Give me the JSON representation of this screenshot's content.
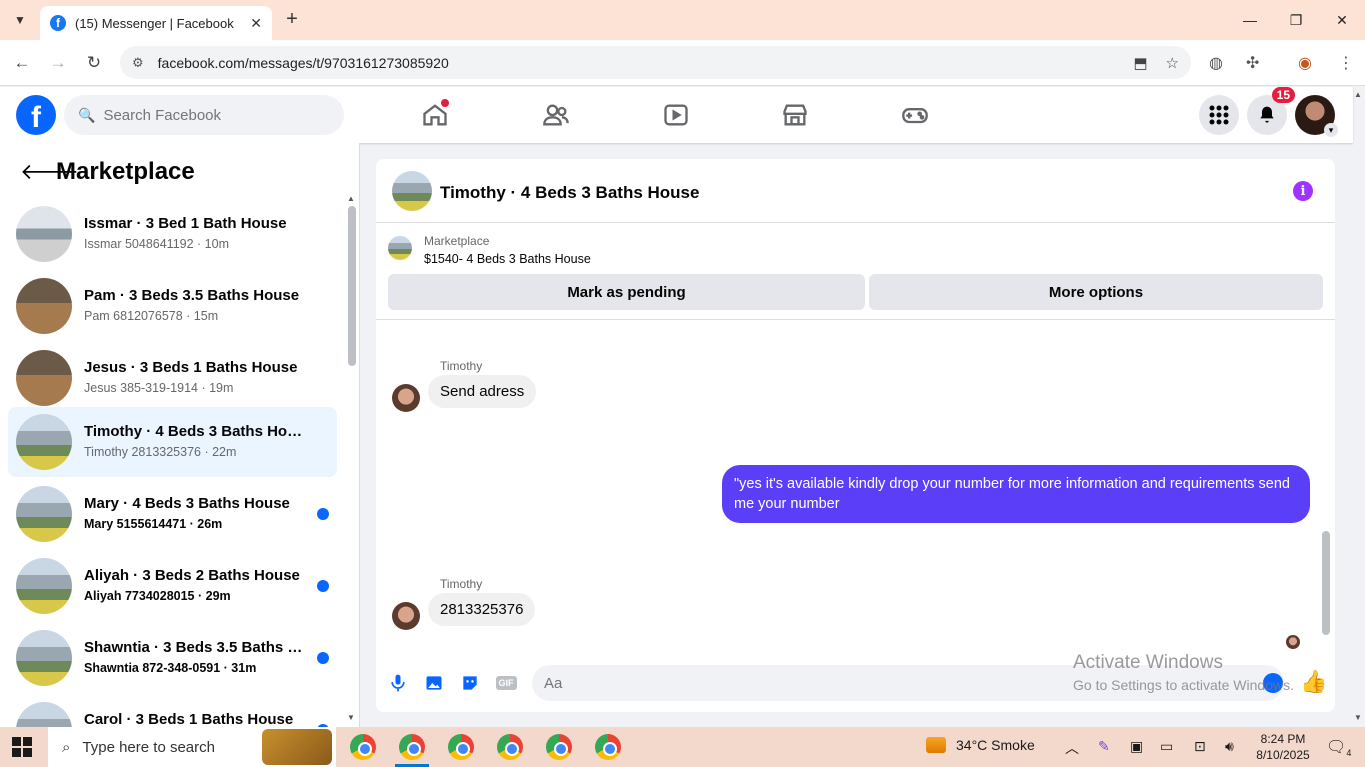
{
  "browser": {
    "tab_title": "(15) Messenger | Facebook",
    "url": "facebook.com/messages/t/9703161273085920",
    "tab_favicon_letter": "f"
  },
  "fb_header": {
    "logo_letter": "f",
    "search_placeholder": "Search Facebook",
    "notification_count": "15",
    "nav_icons": [
      "home-icon",
      "friends-icon",
      "video-icon",
      "marketplace-icon",
      "gaming-icon"
    ]
  },
  "sidebar": {
    "title": "Marketplace",
    "conversations": [
      {
        "name": "Issmar · 3 Bed 1 Bath House",
        "meta": "Issmar 5048641192 · 10m",
        "unread": false,
        "active": false
      },
      {
        "name": "Pam · 3 Beds 3.5 Baths House",
        "meta": "Pam 6812076578 · 15m",
        "unread": false,
        "active": false
      },
      {
        "name": "Jesus · 3 Beds 1 Baths House",
        "meta": "Jesus 385-319-1914 · 19m",
        "unread": false,
        "active": false
      },
      {
        "name": "Timothy · 4 Beds 3 Baths House",
        "meta": "Timothy 2813325376 · 22m",
        "unread": false,
        "active": true
      },
      {
        "name": "Mary · 4 Beds 3 Baths House",
        "meta": "Mary 5155614471 · 26m",
        "unread": true,
        "active": false
      },
      {
        "name": "Aliyah · 3 Beds 2 Baths House",
        "meta": "Aliyah 7734028015 · 29m",
        "unread": true,
        "active": false
      },
      {
        "name": "Shawntia · 3 Beds 3.5 Baths H...",
        "meta": "Shawntia 872-348-0591 · 31m",
        "unread": true,
        "active": false
      },
      {
        "name": "Carol · 3 Beds 1 Baths House",
        "meta": "",
        "unread": true,
        "active": false
      }
    ]
  },
  "chat": {
    "title": "Timothy · 4 Beds 3 Baths House",
    "marketplace_label": "Marketplace",
    "listing": "$1540- 4 Beds 3 Baths House",
    "mark_pending_label": "Mark as pending",
    "more_options_label": "More options",
    "messages": [
      {
        "sender": "Timothy",
        "text": "Send adress",
        "direction": "in"
      },
      {
        "sender": "",
        "text": "\"yes it's available kindly drop your number for more information and requirements send me your number",
        "direction": "out"
      },
      {
        "sender": "Timothy",
        "text": "2813325376",
        "direction": "in"
      }
    ],
    "composer_placeholder": "Aa",
    "gif_label": "GIF"
  },
  "watermark": {
    "line1": "Activate Windows",
    "line2": "Go to Settings to activate Windows."
  },
  "taskbar": {
    "search_placeholder": "Type here to search",
    "weather": "34°C  Smoke",
    "time": "8:24 PM",
    "date": "8/10/2025",
    "notification_count": "4"
  },
  "colors": {
    "fb_blue": "#0866ff",
    "outgoing_bubble": "#5b3ff8",
    "info_purple": "#a033ff",
    "badge_red": "#e41e3f"
  }
}
